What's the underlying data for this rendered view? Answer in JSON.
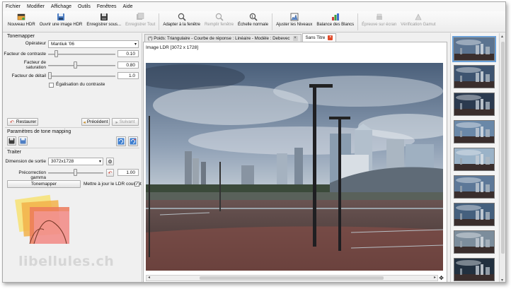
{
  "menu": [
    "Fichier",
    "Modifier",
    "Affichage",
    "Outils",
    "Fenêtres",
    "Aide"
  ],
  "toolbar": {
    "new_hdr": "Nouveau HDR",
    "open_hdr": "Ouvrir une image HDR",
    "save_as": "Enregistrer sous...",
    "save_all": "Enregistrer Tout",
    "fit_window": "Adapter à la fenêtre",
    "fill_window": "Remplir fenêtre",
    "normal_scale": "Échelle normale",
    "levels": "Ajuster les Niveaux",
    "white_balance": "Balance des Blancs",
    "soft_proof": "Épreuve sur écran",
    "gamut_check": "Vérification Gamut"
  },
  "tonemapper": {
    "section": "Tonemapper",
    "operator_label": "Opérateur",
    "operator_value": "Mantiuk '06",
    "contrast_label": "Facteur de contraste",
    "contrast_value": "0.10",
    "contrast_level": 0.1,
    "saturation_label": "Facteur de saturation",
    "saturation_value": "0.80",
    "saturation_level": 0.4,
    "detail_label": "Facteur de détail",
    "detail_value": "1.0",
    "detail_level": 0.0,
    "equalize_label": "Égalisation du contraste",
    "restore": "Restaurer",
    "previous": "Précédent",
    "next": "Suivant"
  },
  "params": {
    "section": "Paramètres de tone mapping"
  },
  "process": {
    "section": "Traiter",
    "size_label": "Dimension de sortie",
    "size_value": "3072x1728",
    "gamma_label": "Précorrection gamma",
    "gamma_value": "1.00",
    "gamma_level": 0.5,
    "tonemap_button": "Tonemapper",
    "update_ldr": "Mettre à jour le LDR courant"
  },
  "tabs": [
    {
      "label": "(*) Poids: Triangulaire - Courbe de réponse : Linéaire - Modèle : Debevec"
    },
    {
      "label": "Sans Titre"
    }
  ],
  "image_label": "Image LDR [3072 x 1728]",
  "watermark": "libellules.ch",
  "colors": {
    "accent": "#6aa0d8",
    "tab_close_active": "#e04a2a"
  }
}
